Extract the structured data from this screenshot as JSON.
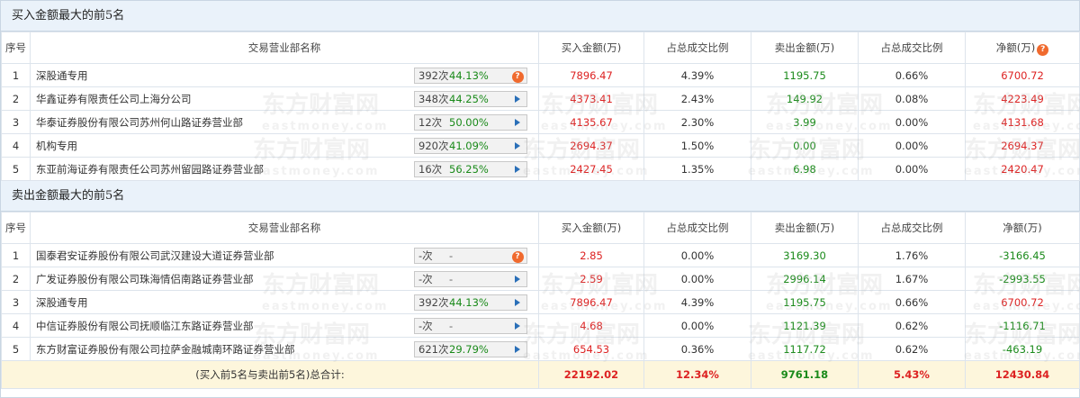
{
  "buy_section": {
    "title": "买入金额最大的前5名",
    "headers": [
      "序号",
      "交易营业部名称",
      "买入金额(万)",
      "占总成交比例",
      "卖出金额(万)",
      "占总成交比例",
      "净额(万)"
    ],
    "rows": [
      {
        "idx": "1",
        "name": "深股通专用",
        "count": "392次",
        "pct": "44.13%",
        "icon": "question-icon",
        "buy": "7896.47",
        "buy_ratio": "4.39%",
        "sell": "1195.75",
        "sell_ratio": "0.66%",
        "net": "6700.72"
      },
      {
        "idx": "2",
        "name": "华鑫证券有限责任公司上海分公司",
        "count": "348次",
        "pct": "44.25%",
        "icon": "play-icon",
        "buy": "4373.41",
        "buy_ratio": "2.43%",
        "sell": "149.92",
        "sell_ratio": "0.08%",
        "net": "4223.49"
      },
      {
        "idx": "3",
        "name": "华泰证券股份有限公司苏州何山路证券营业部",
        "count": "12次",
        "pct": "50.00%",
        "icon": "play-icon",
        "buy": "4135.67",
        "buy_ratio": "2.30%",
        "sell": "3.99",
        "sell_ratio": "0.00%",
        "net": "4131.68"
      },
      {
        "idx": "4",
        "name": "机构专用",
        "count": "920次",
        "pct": "41.09%",
        "icon": "play-icon",
        "buy": "2694.37",
        "buy_ratio": "1.50%",
        "sell": "0.00",
        "sell_ratio": "0.00%",
        "net": "2694.37"
      },
      {
        "idx": "5",
        "name": "东亚前海证券有限责任公司苏州留园路证券营业部",
        "count": "16次",
        "pct": "56.25%",
        "icon": "play-icon",
        "buy": "2427.45",
        "buy_ratio": "1.35%",
        "sell": "6.98",
        "sell_ratio": "0.00%",
        "net": "2420.47"
      }
    ]
  },
  "sell_section": {
    "title": "卖出金额最大的前5名",
    "headers": [
      "序号",
      "交易营业部名称",
      "买入金额(万)",
      "占总成交比例",
      "卖出金额(万)",
      "占总成交比例",
      "净额(万)"
    ],
    "rows": [
      {
        "idx": "1",
        "name": "国泰君安证券股份有限公司武汉建设大道证券营业部",
        "count": "-次",
        "pct": "-",
        "icon": "question-icon",
        "buy": "2.85",
        "buy_ratio": "0.00%",
        "sell": "3169.30",
        "sell_ratio": "1.76%",
        "net": "-3166.45"
      },
      {
        "idx": "2",
        "name": "广发证券股份有限公司珠海情侣南路证券营业部",
        "count": "-次",
        "pct": "-",
        "icon": "play-icon",
        "buy": "2.59",
        "buy_ratio": "0.00%",
        "sell": "2996.14",
        "sell_ratio": "1.67%",
        "net": "-2993.55"
      },
      {
        "idx": "3",
        "name": "深股通专用",
        "count": "392次",
        "pct": "44.13%",
        "icon": "play-icon",
        "buy": "7896.47",
        "buy_ratio": "4.39%",
        "sell": "1195.75",
        "sell_ratio": "0.66%",
        "net": "6700.72"
      },
      {
        "idx": "4",
        "name": "中信证券股份有限公司抚顺临江东路证券营业部",
        "count": "-次",
        "pct": "-",
        "icon": "play-icon",
        "buy": "4.68",
        "buy_ratio": "0.00%",
        "sell": "1121.39",
        "sell_ratio": "0.62%",
        "net": "-1116.71"
      },
      {
        "idx": "5",
        "name": "东方财富证券股份有限公司拉萨金融城南环路证券营业部",
        "count": "621次",
        "pct": "29.79%",
        "icon": "play-icon",
        "buy": "654.53",
        "buy_ratio": "0.36%",
        "sell": "1117.72",
        "sell_ratio": "0.62%",
        "net": "-463.19"
      }
    ]
  },
  "total": {
    "label": "(买入前5名与卖出前5名)总合计:",
    "buy": "22192.02",
    "buy_ratio": "12.34%",
    "sell": "9761.18",
    "sell_ratio": "5.43%",
    "net": "12430.84"
  },
  "watermark": {
    "cn": "东方财富网",
    "en": "eastmoney.com"
  },
  "colors": {
    "positive": "#d22",
    "negative": "#1a8a1a",
    "header_bg": "#eaf2fa",
    "total_bg": "#fdf6dc",
    "icon_orange": "#f06a2e",
    "icon_blue": "#2a6fb8"
  }
}
